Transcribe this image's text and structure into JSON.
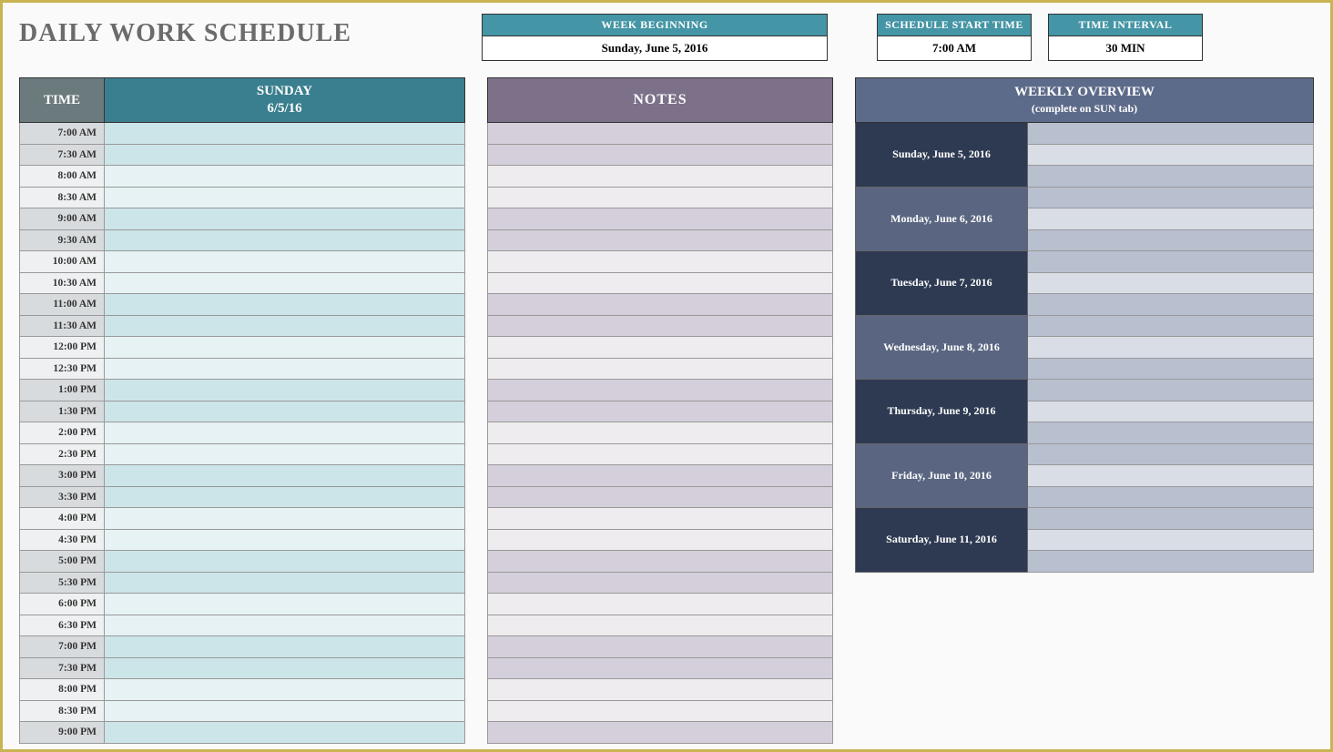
{
  "title": "DAILY WORK SCHEDULE",
  "info": {
    "week_label": "WEEK BEGINNING",
    "week_value": "Sunday, June 5, 2016",
    "start_label": "SCHEDULE START TIME",
    "start_value": "7:00 AM",
    "interval_label": "TIME INTERVAL",
    "interval_value": "30 MIN"
  },
  "schedule": {
    "time_header": "TIME",
    "day_name": "SUNDAY",
    "day_date": "6/5/16",
    "times": [
      "7:00 AM",
      "7:30 AM",
      "8:00 AM",
      "8:30 AM",
      "9:00 AM",
      "9:30 AM",
      "10:00 AM",
      "10:30 AM",
      "11:00 AM",
      "11:30 AM",
      "12:00 PM",
      "12:30 PM",
      "1:00 PM",
      "1:30 PM",
      "2:00 PM",
      "2:30 PM",
      "3:00 PM",
      "3:30 PM",
      "4:00 PM",
      "4:30 PM",
      "5:00 PM",
      "5:30 PM",
      "6:00 PM",
      "6:30 PM",
      "7:00 PM",
      "7:30 PM",
      "8:00 PM",
      "8:30 PM",
      "9:00 PM"
    ]
  },
  "notes": {
    "header": "NOTES",
    "row_count": 29
  },
  "weekly": {
    "header": "WEEKLY OVERVIEW",
    "subheader": "(complete on SUN tab)",
    "days": [
      "Sunday, June 5, 2016",
      "Monday, June 6, 2016",
      "Tuesday, June 7, 2016",
      "Wednesday, June 8, 2016",
      "Thursday, June 9, 2016",
      "Friday, June 10, 2016",
      "Saturday, June 11, 2016"
    ]
  }
}
